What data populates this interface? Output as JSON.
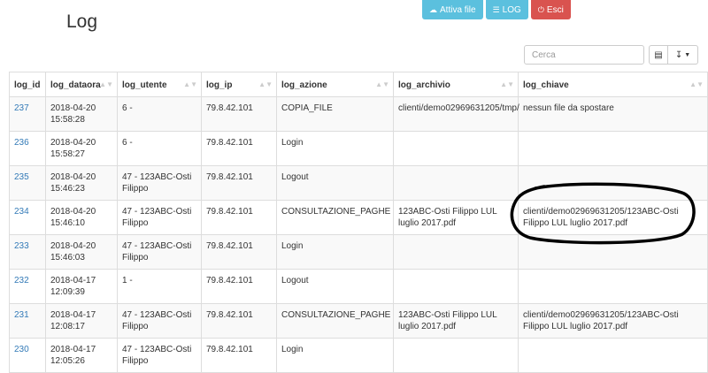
{
  "header": {
    "title": "Log",
    "buttons": [
      {
        "label": "Attiva file",
        "icon": "cloud-icon"
      },
      {
        "label": "LOG",
        "icon": "list-icon"
      },
      {
        "label": "Esci",
        "icon": "power-icon"
      }
    ]
  },
  "toolbar": {
    "search_placeholder": "Cerca",
    "columns_icon": "columns-icon",
    "export_icon": "export-icon"
  },
  "table": {
    "columns": [
      "log_id",
      "log_dataora",
      "log_utente",
      "log_ip",
      "log_azione",
      "log_archivio",
      "log_chiave"
    ],
    "rows": [
      {
        "id": "237",
        "dataora": "2018-04-20 15:58:28",
        "utente": "6 -",
        "ip": "79.8.42.101",
        "azione": "COPIA_FILE",
        "archivio": "clienti/demo02969631205/tmp/",
        "chiave": "nessun file da spostare"
      },
      {
        "id": "236",
        "dataora": "2018-04-20 15:58:27",
        "utente": "6 -",
        "ip": "79.8.42.101",
        "azione": "Login",
        "archivio": "",
        "chiave": ""
      },
      {
        "id": "235",
        "dataora": "2018-04-20 15:46:23",
        "utente": "47 - 123ABC-Osti Filippo",
        "ip": "79.8.42.101",
        "azione": "Logout",
        "archivio": "",
        "chiave": ""
      },
      {
        "id": "234",
        "dataora": "2018-04-20 15:46:10",
        "utente": "47 - 123ABC-Osti Filippo",
        "ip": "79.8.42.101",
        "azione": "CONSULTAZIONE_PAGHE",
        "archivio": "123ABC-Osti Filippo LUL luglio 2017.pdf",
        "chiave": "clienti/demo02969631205/123ABC-Osti Filippo LUL luglio 2017.pdf"
      },
      {
        "id": "233",
        "dataora": "2018-04-20 15:46:03",
        "utente": "47 - 123ABC-Osti Filippo",
        "ip": "79.8.42.101",
        "azione": "Login",
        "archivio": "",
        "chiave": ""
      },
      {
        "id": "232",
        "dataora": "2018-04-17 12:09:39",
        "utente": "1 -",
        "ip": "79.8.42.101",
        "azione": "Logout",
        "archivio": "",
        "chiave": ""
      },
      {
        "id": "231",
        "dataora": "2018-04-17 12:08:17",
        "utente": "47 - 123ABC-Osti Filippo",
        "ip": "79.8.42.101",
        "azione": "CONSULTAZIONE_PAGHE",
        "archivio": "123ABC-Osti Filippo LUL luglio 2017.pdf",
        "chiave": "clienti/demo02969631205/123ABC-Osti Filippo LUL luglio 2017.pdf"
      },
      {
        "id": "230",
        "dataora": "2018-04-17 12:05:26",
        "utente": "47 - 123ABC-Osti Filippo",
        "ip": "79.8.42.101",
        "azione": "Login",
        "archivio": "",
        "chiave": ""
      }
    ]
  },
  "colors": {
    "info_button": "#5bc0de",
    "danger_button": "#d9534f",
    "link": "#337ab7",
    "annotation": "#000000"
  }
}
